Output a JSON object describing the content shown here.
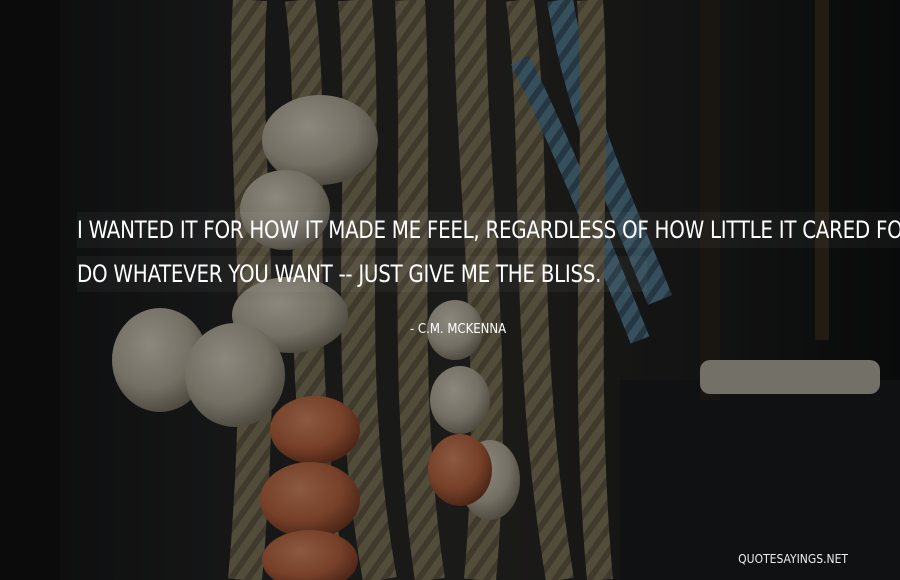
{
  "quote": {
    "line1": "I WANTED IT FOR HOW IT MADE ME FEEL, REGARDLESS OF HOW LITTLE IT CARED FOR ME.",
    "line2": "DO WHATEVER YOU WANT -- JUST GIVE ME THE BLISS.",
    "author": "- C.M. MCKENNA"
  },
  "watermark": "QUOTESAYINGS.NET",
  "colors": {
    "overlay": "#000000",
    "text": "#ffffff",
    "rope": "#8a8066",
    "rope_blue": "#4f7890",
    "float_white": "#d9d2c0",
    "float_orange": "#d77a52",
    "wood": "#2b2520"
  }
}
